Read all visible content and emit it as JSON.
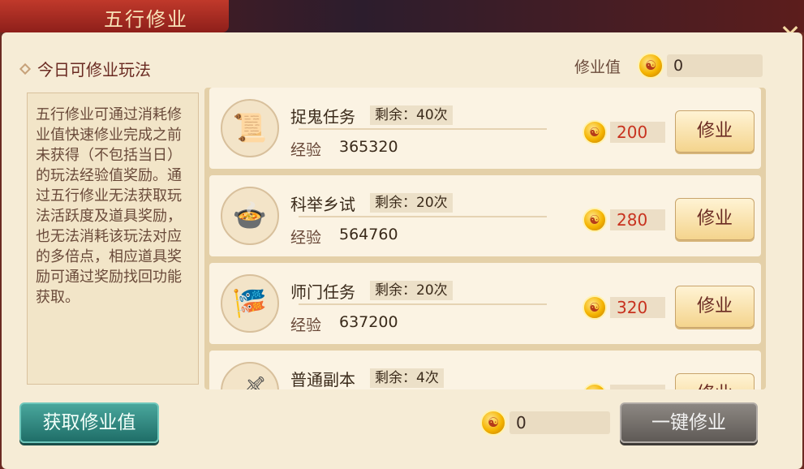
{
  "window": {
    "title": "五行修业",
    "close_icon": "✕"
  },
  "header": {
    "section_title": "今日可修业玩法",
    "practice_label": "修业值",
    "practice_value": "0"
  },
  "description": "五行修业可通过消耗修业值快速修业完成之前未获得（不包括当日）的玩法经验值奖励。通过五行修业无法获取玩法活跃度及道具奖励，也无法消耗该玩法对应的多倍点，相应道具奖励可通过奖励找回功能获取。",
  "rows": [
    {
      "name": "捉鬼任务",
      "remain": "剩余：40次",
      "exp_label": "经验",
      "exp": "365320",
      "cost": "200",
      "button": "修业",
      "icon": "scroll-icon"
    },
    {
      "name": "科举乡试",
      "remain": "剩余：20次",
      "exp_label": "经验",
      "exp": "564760",
      "cost": "280",
      "button": "修业",
      "icon": "bowl-icon"
    },
    {
      "name": "师门任务",
      "remain": "剩余：20次",
      "exp_label": "经验",
      "exp": "637200",
      "cost": "320",
      "button": "修业",
      "icon": "banner-icon"
    },
    {
      "name": "普通副本",
      "remain": "剩余：4次",
      "exp_label": "",
      "exp": "",
      "cost": "",
      "button": "修业",
      "icon": "sword-icon"
    }
  ],
  "footer": {
    "get_button": "获取修业值",
    "total_value": "0",
    "oneclick_button": "一键修业"
  },
  "colors": {
    "accent": "#8e1f1a",
    "panel": "#f6ecd6",
    "teal": "#1f6e68"
  }
}
